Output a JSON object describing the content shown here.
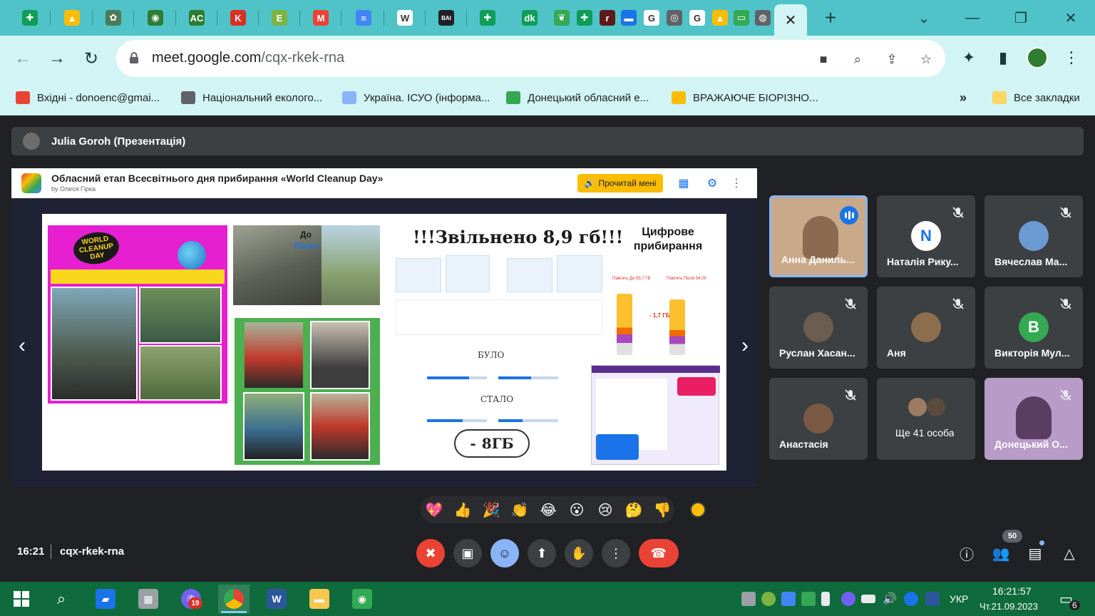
{
  "browser": {
    "tab_close": "✕",
    "new_tab": "+",
    "url_domain": "meet.google.com",
    "url_path": "/cqx-rkek-rna",
    "bookmarks": [
      {
        "label": "Вхідні - donoenc@gmai...",
        "color": "#ea4335"
      },
      {
        "label": "Національний еколого...",
        "color": "#5f6368"
      },
      {
        "label": "Україна. ІСУО (інформа...",
        "color": "#8ab4f8"
      },
      {
        "label": "Донецький обласний е...",
        "color": "#34a853"
      },
      {
        "label": "ВРАЖАЮЧЕ БІОРІЗНО...",
        "color": "#fbbc04"
      }
    ],
    "bookmarks_more": "»",
    "all_bookmarks": "Все закладки",
    "pinned_tabs": [
      {
        "icon": "plus-doc-icon",
        "glyph": "✚",
        "color": "#0f9d58"
      },
      {
        "icon": "drive-icon",
        "glyph": "▲",
        "color": "#fbbc04"
      },
      {
        "icon": "eco-icon",
        "glyph": "✿",
        "color": "#4a7c59"
      },
      {
        "icon": "emblem-icon",
        "glyph": "◉",
        "color": "#2e7d32"
      },
      {
        "icon": "ac-icon",
        "glyph": "AC",
        "color": "#2e7d32"
      },
      {
        "icon": "k-icon",
        "glyph": "K",
        "color": "#d93025"
      },
      {
        "icon": "e-icon",
        "glyph": "E",
        "color": "#7cb342"
      },
      {
        "icon": "gmail-icon",
        "glyph": "M",
        "color": "#ea4335"
      },
      {
        "icon": "docs-icon",
        "glyph": "≡",
        "color": "#4285f4"
      },
      {
        "icon": "wikipedia-icon",
        "glyph": "W",
        "color": "#ffffff"
      },
      {
        "icon": "bai-icon",
        "glyph": "BAI",
        "color": "#202124"
      },
      {
        "icon": "plus-doc-icon",
        "glyph": "✚",
        "color": "#0f9d58"
      },
      {
        "icon": "dk-icon",
        "glyph": "dk",
        "color": "#0f9d58"
      },
      {
        "icon": "leaf-icon",
        "glyph": "❦",
        "color": "#34a853"
      },
      {
        "icon": "plus-doc-icon",
        "glyph": "✚",
        "color": "#0f9d58"
      },
      {
        "icon": "r-icon",
        "glyph": "r",
        "color": "#5d1a1a"
      },
      {
        "icon": "flag-icon",
        "glyph": "▬",
        "color": "#1a73e8"
      },
      {
        "icon": "google-icon",
        "glyph": "G",
        "color": "#ffffff"
      },
      {
        "icon": "chrome-icon",
        "glyph": "◎",
        "color": "#5f6368"
      },
      {
        "icon": "google-icon",
        "glyph": "G",
        "color": "#ffffff"
      },
      {
        "icon": "bell-icon",
        "glyph": "▲",
        "color": "#fbbc04"
      },
      {
        "icon": "slides-icon",
        "glyph": "▭",
        "color": "#34a853"
      },
      {
        "icon": "globe-icon",
        "glyph": "◍",
        "color": "#5f6368"
      }
    ]
  },
  "meet": {
    "presenter": "Julia Goroh (Презентація)",
    "time": "16:21",
    "meeting_code": "cqx-rkek-rna",
    "people_count": "50",
    "slides_header": {
      "title": "Обласний етап Всесвітнього дня прибирання «World Cleanup Day»",
      "author": "by Олеся Гірка",
      "read_button": "Прочитай мені"
    },
    "slide": {
      "wcd_logo": [
        "WORLD",
        "CLEANUP",
        "DAY"
      ],
      "before_label": "До",
      "after_label": "Після",
      "freed_title": "!!!Звільнено 8,9 гб!!!",
      "digital_title": "Цифрове прибирання",
      "was_label": "БУЛО",
      "became_label": "СТАЛО",
      "cloud_minus": "-",
      "cloud_value": "8ГБ",
      "chart_before": "Памʼять До 55,7 ГБ",
      "chart_after": "Памʼять Після 54,00",
      "chart_diff": "- 1,7 ГБ"
    },
    "participants": [
      {
        "name": "Анна Даниль...",
        "initial": "",
        "bg": "#c9a98a",
        "av": "",
        "speaking": true,
        "muted": false
      },
      {
        "name": "Наталія Рику...",
        "initial": "N",
        "bg": "#3c4043",
        "av": "#ffffff",
        "speaking": false,
        "muted": true
      },
      {
        "name": "Вячеслав Ма...",
        "initial": "",
        "bg": "#3c4043",
        "av": "#6c9bd2",
        "speaking": false,
        "muted": true
      },
      {
        "name": "Руслан Хасан...",
        "initial": "",
        "bg": "#3c4043",
        "av": "#6b5d4f",
        "speaking": false,
        "muted": true
      },
      {
        "name": "Аня",
        "initial": "",
        "bg": "#3c4043",
        "av": "#8c6e4f",
        "speaking": false,
        "muted": true
      },
      {
        "name": "Виктoрія Мул...",
        "initial": "В",
        "bg": "#3c4043",
        "av": "#34a853",
        "speaking": false,
        "muted": true
      },
      {
        "name": "Анастасія",
        "initial": "",
        "bg": "#3c4043",
        "av": "#7a5a44",
        "speaking": false,
        "muted": true
      },
      {
        "name": "Ще 41 особа",
        "initial": "",
        "bg": "#3c4043",
        "av": "",
        "speaking": false,
        "muted": false
      },
      {
        "name": "Донецький О...",
        "initial": "",
        "bg": "#b89bc6",
        "av": "",
        "speaking": false,
        "muted": true
      }
    ],
    "reactions": [
      "💖",
      "👍",
      "🎉",
      "👏",
      "😂",
      "😮",
      "😢",
      "🤔",
      "👎"
    ]
  },
  "taskbar": {
    "clock_time": "16:21:57",
    "clock_date": "Чт.21.09.2023",
    "lang": "УКР",
    "viber_badge": "19",
    "notif_count": "6"
  }
}
